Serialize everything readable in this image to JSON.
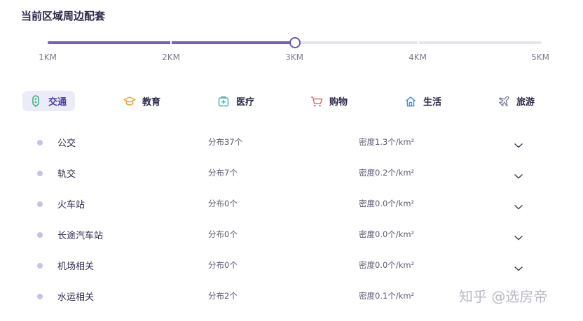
{
  "title": "当前区域周边配套",
  "distance_slider": {
    "labels": [
      "1KM",
      "2KM",
      "3KM",
      "4KM",
      "5KM"
    ],
    "selected": "3KM",
    "selected_index": 2
  },
  "colors": {
    "accent": "#6a56b8",
    "track": "#e6e5f3",
    "active_tab_bg": "#ecebf8",
    "bullet": "#c5c2ea",
    "icon_education": "#e8a23a",
    "icon_medical": "#3bb8b0",
    "icon_shopping": "#e86a6a",
    "icon_life": "#4a8fe0",
    "icon_travel": "#7a7f9a"
  },
  "tabs": [
    {
      "label": "交通",
      "icon": "transit-icon",
      "active": true
    },
    {
      "label": "教育",
      "icon": "graduation-cap-icon",
      "active": false
    },
    {
      "label": "医疗",
      "icon": "medical-kit-icon",
      "active": false
    },
    {
      "label": "购物",
      "icon": "shopping-cart-icon",
      "active": false
    },
    {
      "label": "生活",
      "icon": "home-icon",
      "active": false
    },
    {
      "label": "旅游",
      "icon": "airplane-icon",
      "active": false
    }
  ],
  "rows": [
    {
      "category": "公交",
      "distribution": "分布37个",
      "density": "密度1.3个/km²"
    },
    {
      "category": "轨交",
      "distribution": "分布7个",
      "density": "密度0.2个/km²"
    },
    {
      "category": "火车站",
      "distribution": "分布0个",
      "density": "密度0.0个/km²"
    },
    {
      "category": "长途汽车站",
      "distribution": "分布0个",
      "density": "密度0.0个/km²"
    },
    {
      "category": "机场相关",
      "distribution": "分布0个",
      "density": "密度0.0个/km²"
    },
    {
      "category": "水运相关",
      "distribution": "分布2个",
      "density": "密度0.1个/km²"
    }
  ],
  "watermark": "知乎 @选房帝"
}
